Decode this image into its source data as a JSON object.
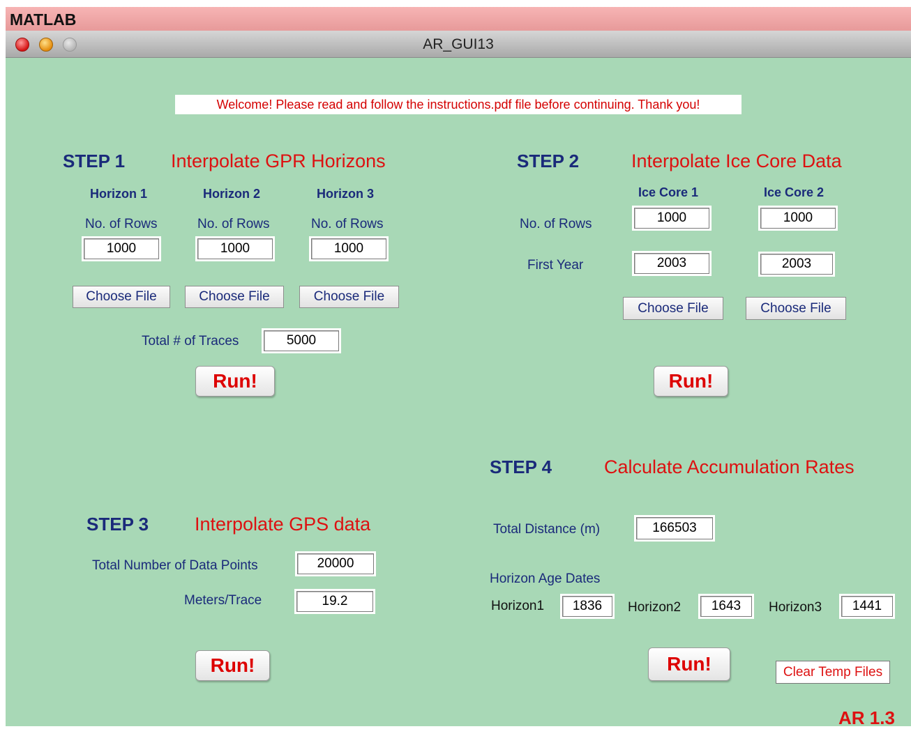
{
  "app_name": "MATLAB",
  "window_title": "AR_GUI13",
  "welcome": "Welcome! Please read and follow the instructions.pdf file before continuing. Thank you!",
  "step1": {
    "step": "STEP 1",
    "heading": "Interpolate GPR Horizons",
    "horizons": [
      {
        "label": "Horizon 1",
        "rows_label": "No. of Rows",
        "rows": "1000",
        "choose": "Choose File"
      },
      {
        "label": "Horizon 2",
        "rows_label": "No. of Rows",
        "rows": "1000",
        "choose": "Choose File"
      },
      {
        "label": "Horizon 3",
        "rows_label": "No. of Rows",
        "rows": "1000",
        "choose": "Choose File"
      }
    ],
    "traces_label": "Total # of Traces",
    "traces": "5000",
    "run": "Run!"
  },
  "step2": {
    "step": "STEP 2",
    "heading": "Interpolate Ice Core Data",
    "cores": [
      {
        "label": "Ice Core 1",
        "rows": "1000",
        "first_year": "2003",
        "choose": "Choose File"
      },
      {
        "label": "Ice Core 2",
        "rows": "1000",
        "first_year": "2003",
        "choose": "Choose File"
      }
    ],
    "rows_label": "No. of Rows",
    "first_year_label": "First Year",
    "run": "Run!"
  },
  "step3": {
    "step": "STEP 3",
    "heading": "Interpolate GPS data",
    "points_label": "Total Number of Data Points",
    "points": "20000",
    "meters_label": "Meters/Trace",
    "meters": "19.2",
    "run": "Run!"
  },
  "step4": {
    "step": "STEP 4",
    "heading": "Calculate Accumulation Rates",
    "distance_label": "Total Distance (m)",
    "distance": "166503",
    "age_label": "Horizon Age Dates",
    "ages": [
      {
        "label": "Horizon1",
        "value": "1836"
      },
      {
        "label": "Horizon2",
        "value": "1643"
      },
      {
        "label": "Horizon3",
        "value": "1441"
      }
    ],
    "run": "Run!"
  },
  "clear_temp": "Clear Temp Files",
  "version": "AR 1.3",
  "colors": {
    "background": "#a8d8b6",
    "heading": "#dd1111",
    "label": "#1a2a7a"
  }
}
